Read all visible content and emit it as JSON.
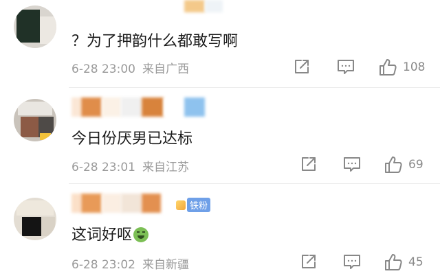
{
  "comments": [
    {
      "text": "？为了押韵什么都敢写啊",
      "date": "6-28 23:00",
      "location": "来自广西",
      "likes": "108",
      "fan_badge": ""
    },
    {
      "text": "今日份厌男已达标",
      "date": "6-28 23:01",
      "location": "来自江苏",
      "likes": "69",
      "fan_badge": ""
    },
    {
      "text": "这词好呕",
      "date": "6-28 23:02",
      "location": "来自新疆",
      "likes": "45",
      "fan_badge": "铁粉"
    }
  ],
  "icons": {
    "share": "share-icon",
    "reply": "comment-icon",
    "like": "thumbs-up-icon",
    "emoji": "vomiting-face-emoji"
  },
  "colors": {
    "meta_text": "#9a9a9a",
    "fan_badge": "#6fa0e8"
  }
}
